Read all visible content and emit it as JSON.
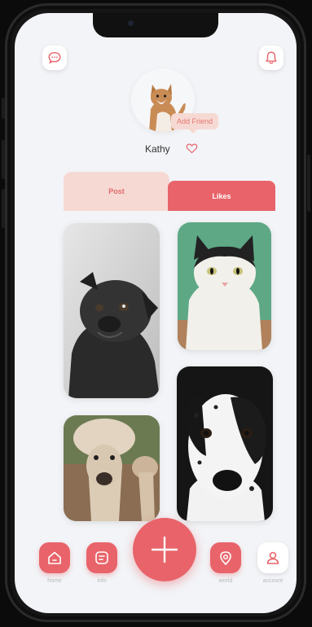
{
  "profile": {
    "name": "Kathy",
    "add_friend_label": "Add Friend"
  },
  "tabs": {
    "post_label": "Post",
    "likes_label": "Likes"
  },
  "posts": [
    {
      "subject": "pug"
    },
    {
      "subject": "cat"
    },
    {
      "subject": "alpaca"
    },
    {
      "subject": "dalmatian"
    }
  ],
  "nav": {
    "items": [
      {
        "label": "home",
        "icon": "home-icon"
      },
      {
        "label": "info",
        "icon": "info-icon"
      },
      {
        "label": "",
        "icon": "plus-icon"
      },
      {
        "label": "world",
        "icon": "location-icon"
      },
      {
        "label": "account",
        "icon": "user-icon"
      }
    ]
  },
  "colors": {
    "accent": "#e8646a",
    "accent_light": "#f7d9d4",
    "background": "#f2f4f7"
  }
}
